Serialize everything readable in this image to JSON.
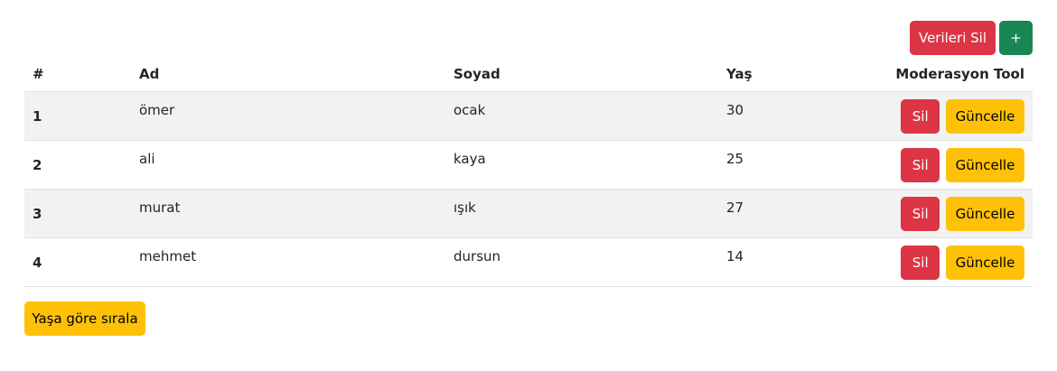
{
  "toolbar": {
    "delete_all_label": "Verileri Sil",
    "add_label": "+"
  },
  "table": {
    "headers": [
      "#",
      "Ad",
      "Soyad",
      "Yaş",
      "Moderasyon Tool"
    ],
    "rows": [
      {
        "index": "1",
        "ad": "ömer",
        "soyad": "ocak",
        "yas": "30"
      },
      {
        "index": "2",
        "ad": "ali",
        "soyad": "kaya",
        "yas": "25"
      },
      {
        "index": "3",
        "ad": "murat",
        "soyad": "ışık",
        "yas": "27"
      },
      {
        "index": "4",
        "ad": "mehmet",
        "soyad": "dursun",
        "yas": "14"
      }
    ],
    "row_actions": {
      "delete_label": "Sil",
      "update_label": "Güncelle"
    }
  },
  "footer": {
    "sort_label": "Yaşa göre sırala"
  },
  "colors": {
    "danger": "#dc3545",
    "success": "#198754",
    "warning": "#ffc107"
  }
}
